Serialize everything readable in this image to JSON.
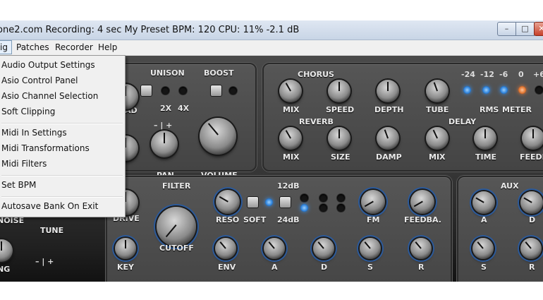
{
  "titlebar": {
    "text": "one2.com    Recording: 4 sec    My Preset    BPM: 120    CPU: 11%    -2.1 dB",
    "min_glyph": "–",
    "max_glyph": "□",
    "close_glyph": "✕"
  },
  "menubar": {
    "items": [
      "ig",
      "Patches",
      "Recorder",
      "Help"
    ]
  },
  "dropdown": {
    "items": [
      "Audio Output Settings",
      "Asio Control Panel",
      "Asio Channel Selection",
      "Soft Clipping",
      "Midi In Settings",
      "Midi Transformations",
      "Midi Filters",
      "Set BPM",
      "Autosave Bank On Exit"
    ]
  },
  "synth": {
    "unison": {
      "title": "UNISON",
      "opt1": "2X",
      "opt2": "4X"
    },
    "boost": {
      "title": "BOOST"
    },
    "pan": "PAN",
    "volume": "VOLUME",
    "left_labels": {
      "ad": "AD",
      "noise": "NOISE",
      "tune": "TUNE",
      "ng": "NG",
      "plus_minus": "– | +"
    },
    "chorus": {
      "title": "CHORUS",
      "mix": "MIX",
      "speed": "SPEED",
      "depth": "DEPTH"
    },
    "tube": "TUBE",
    "meter": {
      "ticks": [
        "-24",
        "-12",
        "-6",
        "0",
        "+6"
      ],
      "rms": "RMS",
      "meter": "METER"
    },
    "reverb": {
      "title": "REVERB",
      "mix": "MIX",
      "size": "SIZE",
      "damp": "DAMP"
    },
    "delay": {
      "title": "DELAY",
      "mix": "MIX",
      "time": "TIME",
      "feedback": "FEEDB"
    },
    "filter": {
      "title": "FILTER",
      "drive": "DRIVE",
      "cutoff": "CUTOFF",
      "reso": "RESO",
      "soft": "SOFT",
      "db12": "12dB",
      "db24": "24dB",
      "fm": "FM",
      "feedback": "FEEDBA.",
      "key": "KEY",
      "env": "ENV",
      "a": "A",
      "d": "D",
      "s": "S",
      "r": "R"
    },
    "aux": {
      "title": "AUX",
      "a": "A",
      "d": "D",
      "s": "S",
      "r": "R"
    }
  }
}
